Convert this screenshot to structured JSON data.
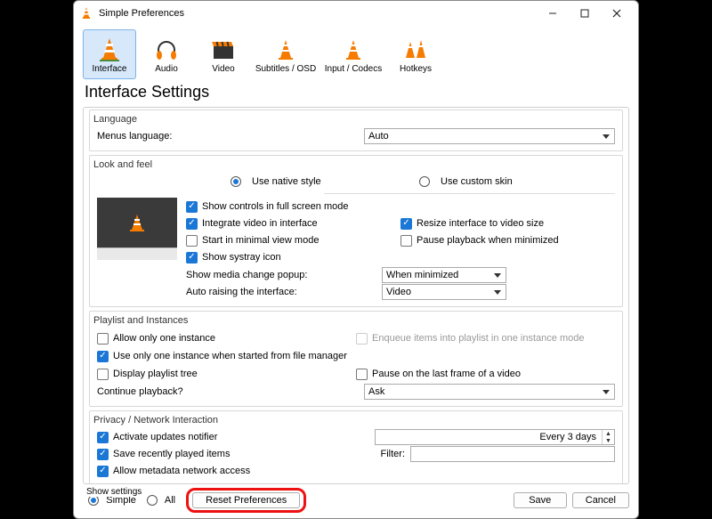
{
  "window": {
    "title": "Simple Preferences"
  },
  "tabs": {
    "interface": "Interface",
    "audio": "Audio",
    "video": "Video",
    "subtitles": "Subtitles / OSD",
    "input": "Input / Codecs",
    "hotkeys": "Hotkeys"
  },
  "heading": "Interface Settings",
  "language": {
    "group": "Language",
    "label": "Menus language:",
    "value": "Auto"
  },
  "look": {
    "group": "Look and feel",
    "native": "Use native style",
    "custom": "Use custom skin",
    "show_controls": "Show controls in full screen mode",
    "integrate": "Integrate video in interface",
    "resize": "Resize interface to video size",
    "start_minimal": "Start in minimal view mode",
    "pause_minimized": "Pause playback when minimized",
    "systray": "Show systray icon",
    "media_popup_label": "Show media change popup:",
    "media_popup_value": "When minimized",
    "auto_raise_label": "Auto raising the interface:",
    "auto_raise_value": "Video"
  },
  "playlist": {
    "group": "Playlist and Instances",
    "one_instance": "Allow only one instance",
    "enqueue": "Enqueue items into playlist in one instance mode",
    "one_from_fm": "Use only one instance when started from file manager",
    "display_tree": "Display playlist tree",
    "pause_last": "Pause on the last frame of a video",
    "continue_label": "Continue playback?",
    "continue_value": "Ask"
  },
  "privacy": {
    "group": "Privacy / Network Interaction",
    "updates": "Activate updates notifier",
    "updates_every": "Every 3 days",
    "recent": "Save recently played items",
    "filter_label": "Filter:",
    "metadata": "Allow metadata network access"
  },
  "footer": {
    "show_settings": "Show settings",
    "simple": "Simple",
    "all": "All",
    "reset": "Reset Preferences",
    "save": "Save",
    "cancel": "Cancel"
  }
}
